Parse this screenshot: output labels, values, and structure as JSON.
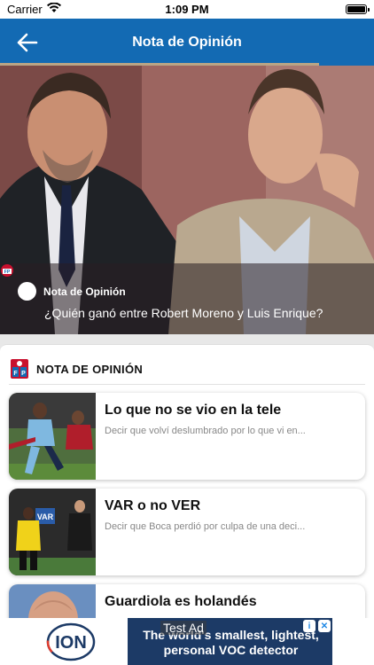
{
  "status_bar": {
    "carrier": "Carrier",
    "time": "1:09 PM"
  },
  "nav": {
    "title": "Nota de Opinión",
    "back_icon": "back-arrow-icon"
  },
  "hero": {
    "tag": "Nota de Opinión",
    "headline": "¿Quién ganó entre Robert Moreno y Luis Enrique?"
  },
  "section": {
    "title": "NOTA DE OPINIÓN",
    "articles": [
      {
        "title": "Lo que no se vio en la tele",
        "excerpt": "Decir que volví deslumbrado por lo que vi en..."
      },
      {
        "title": "VAR o no VER",
        "excerpt": "Decir que Boca perdió por culpa de una deci..."
      },
      {
        "title": "Guardiola es holandés",
        "excerpt": ""
      }
    ]
  },
  "ad": {
    "label": "Test Ad",
    "text": "The world's smallest, lightest, personal VOC detector",
    "brand": "ION"
  },
  "colors": {
    "nav": "#136ab3",
    "accent": "#b9a586"
  }
}
